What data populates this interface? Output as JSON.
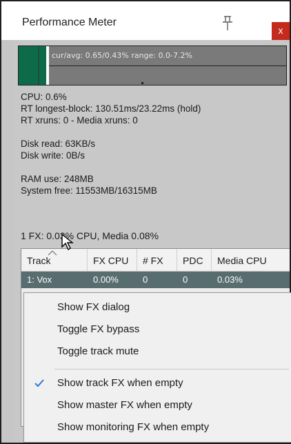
{
  "window": {
    "title": "Performance Meter",
    "close_label": "x"
  },
  "meter": {
    "text": "cur/avg: 0.65/0.43%  range: 0.0-7.2%"
  },
  "stats": {
    "cpu": "CPU: 0.6%",
    "rt_block": "RT longest-block: 130.51ms/23.22ms (hold)",
    "xruns": "RT xruns: 0 - Media xruns: 0",
    "disk_read": "Disk read: 63KB/s",
    "disk_write": "Disk write: 0B/s",
    "ram_use": "RAM use: 248MB",
    "system_free": "System free: 11553MB/16315MB"
  },
  "fx_summary": "1 FX: 0.03% CPU, Media 0.08%",
  "table": {
    "columns": [
      "Track",
      "FX CPU",
      "# FX",
      "PDC",
      "Media CPU"
    ],
    "rows": [
      [
        "1: Vox",
        "0.00%",
        "0",
        "0",
        "0.03%"
      ]
    ]
  },
  "context_menu": {
    "items": [
      "Show FX dialog",
      "Toggle FX bypass",
      "Toggle track mute",
      "Show track FX when empty",
      "Show master FX when empty",
      "Show monitoring FX when empty"
    ]
  },
  "colors": {
    "meter_fill": "#0e6b4a",
    "selected_row": "#586d70",
    "close_button": "#c42b1c",
    "check": "#2a7ad4"
  }
}
